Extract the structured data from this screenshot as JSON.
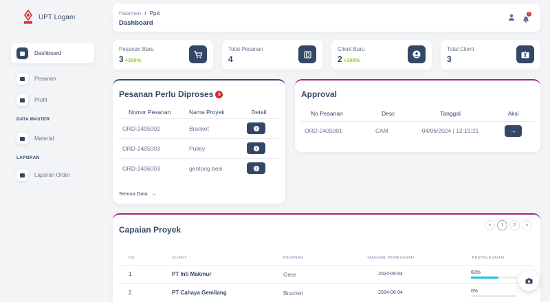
{
  "app": {
    "name": "UPT Logam",
    "logo_text": "LOGAM"
  },
  "sidebar": {
    "items": [
      {
        "label": "Dashboard",
        "icon": "shop-icon"
      },
      {
        "label": "Pesanan",
        "icon": "credit-card-icon"
      },
      {
        "label": "Profil",
        "icon": "user-icon"
      },
      {
        "label": "Material",
        "icon": "box-icon"
      },
      {
        "label": "Laporan Order",
        "icon": "document-icon"
      }
    ],
    "sections": {
      "master": "DATA MASTER",
      "report": "LAPORAN"
    }
  },
  "topbar": {
    "crumb_root": "Halaman",
    "crumb_sep": "/",
    "crumb_current": "Ppic",
    "title": "Dashboard",
    "notif_count": "2"
  },
  "stats": [
    {
      "label": "Pesanan Baru",
      "value": "3",
      "delta": "+200%",
      "icon": "cart-icon"
    },
    {
      "label": "Total Pesanan",
      "value": "4",
      "delta": "",
      "icon": "receipt-icon"
    },
    {
      "label": "Client Baru",
      "value": "2",
      "delta": "+100%",
      "icon": "user-circle-icon"
    },
    {
      "label": "Total Client",
      "value": "3",
      "delta": "",
      "icon": "id-card-icon"
    }
  ],
  "pending": {
    "title": "Pesanan Perlu Diproses",
    "count": "3",
    "headers": [
      "Nomor Pesanan",
      "Nama Proyek",
      "Detail"
    ],
    "rows": [
      {
        "order": "ORD-2405002",
        "project": "Bracket"
      },
      {
        "order": "ORD-2405003",
        "project": "Pulley"
      },
      {
        "order": "ORD-2406003",
        "project": "gentong besi"
      }
    ],
    "see_all": "Semua Data"
  },
  "approval": {
    "title": "Approval",
    "headers": [
      "No Pesanan",
      "Desc",
      "Tanggal",
      "Aksi"
    ],
    "rows": [
      {
        "order": "ORD-2405001",
        "desc": "CAM",
        "date": "04/06/2024 | 12:15:21"
      }
    ]
  },
  "achievement": {
    "title": "Capaian Proyek",
    "pagination": {
      "prev": "«",
      "pages": [
        "1",
        "2"
      ],
      "next": "»",
      "current": "1"
    },
    "headers": [
      "NO",
      "CLIENT",
      "PESANAN",
      "TANGGAL PEMESANAN",
      "PENYELESAIAN"
    ],
    "rows": [
      {
        "no": "1",
        "client": "PT Inti Makmur",
        "order": "Gear",
        "date": "2024-06-04",
        "progress_label": "60%",
        "progress": 0.6
      },
      {
        "no": "2",
        "client": "PT Cahaya Gemilang",
        "order": "Bracket",
        "date": "2024-06-04",
        "progress_label": "0%",
        "progress": 0
      }
    ]
  },
  "colors": {
    "primary_dark": "#344767",
    "accent_magenta": "#a0267a",
    "success": "#82d616",
    "danger": "#d62b2b",
    "progress": "#17c1e8"
  }
}
